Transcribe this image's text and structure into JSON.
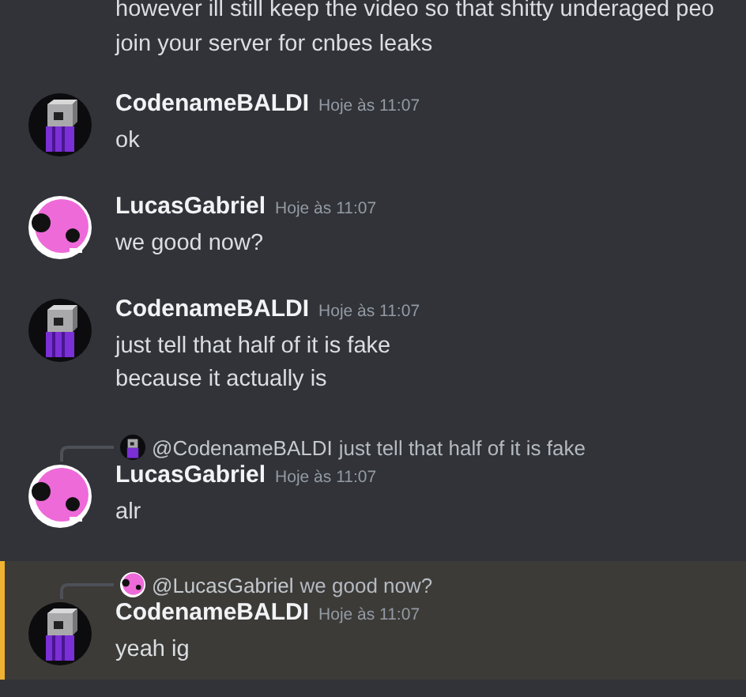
{
  "leading_lines": [
    "however ill still keep the video so that shitty underaged peo",
    "join your server for cnbes leaks"
  ],
  "groups": [
    {
      "avatar": {
        "kind": "cube"
      },
      "author": "CodenameBALDI",
      "time": "Hoje às 11:07",
      "lines": [
        "ok"
      ],
      "highlighted": false
    },
    {
      "avatar": {
        "kind": "pink"
      },
      "author": "LucasGabriel",
      "time": "Hoje às 11:07",
      "lines": [
        "we good now?"
      ],
      "highlighted": false
    },
    {
      "avatar": {
        "kind": "cube"
      },
      "author": "CodenameBALDI",
      "time": "Hoje às 11:07",
      "lines": [
        "just tell that half of it is fake",
        "because it actually is"
      ],
      "highlighted": false
    },
    {
      "avatar": {
        "kind": "pink"
      },
      "author": "LucasGabriel",
      "time": "Hoje às 11:07",
      "reply": {
        "avatar": {
          "kind": "cube"
        },
        "author": "@CodenameBALDI",
        "text": "just tell that half of it is fake"
      },
      "lines": [
        "alr"
      ],
      "highlighted": false
    },
    {
      "avatar": {
        "kind": "cube"
      },
      "author": "CodenameBALDI",
      "time": "Hoje às 11:07",
      "reply": {
        "avatar": {
          "kind": "pink"
        },
        "author": "@LucasGabriel",
        "text": "we good now?"
      },
      "lines": [
        "yeah ig"
      ],
      "highlighted": true
    }
  ]
}
